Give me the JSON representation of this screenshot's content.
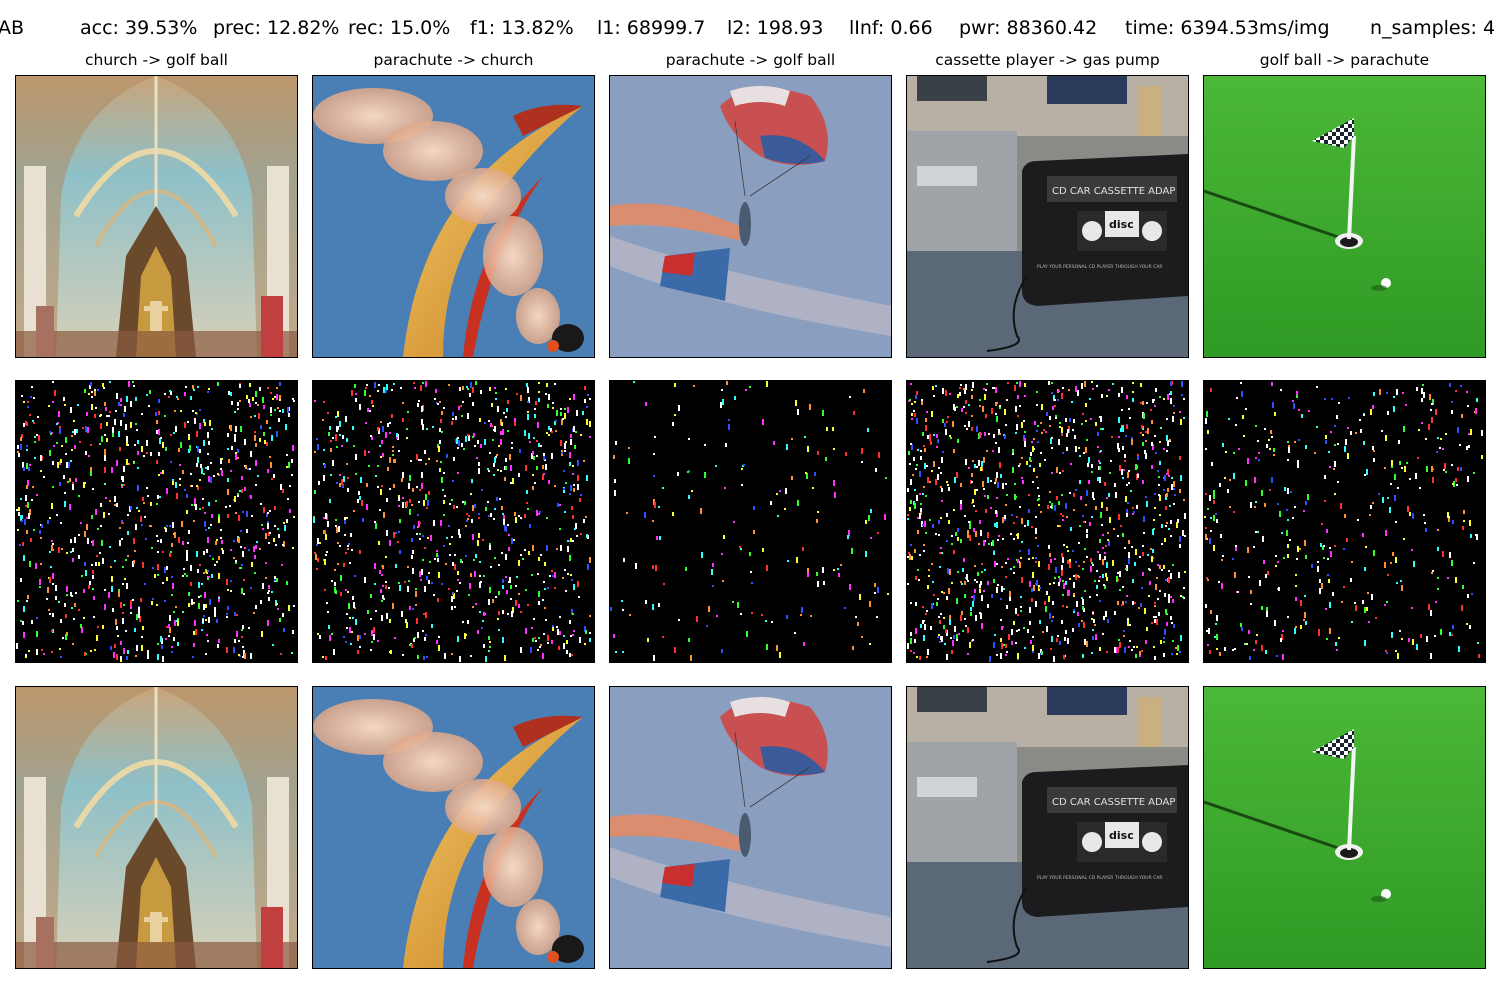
{
  "stats": {
    "method": "AB",
    "acc": "acc: 39.53%",
    "prec": "prec: 12.82%",
    "rec": "rec: 15.0%",
    "f1": "f1: 13.82%",
    "l1": "l1: 68999.7",
    "l2": "l2: 198.93",
    "linf": "lInf: 0.66",
    "pwr": "pwr: 88360.42",
    "time": "time: 6394.53ms/img",
    "n_samples": "n_samples: 4"
  },
  "columns": [
    {
      "title": "church -> golf ball",
      "scene": "church-interior"
    },
    {
      "title": "parachute -> church",
      "scene": "paraglider-smoke"
    },
    {
      "title": "parachute -> golf ball",
      "scene": "parachutist-flag"
    },
    {
      "title": "cassette player -> gas pump",
      "scene": "cassette-adapter"
    },
    {
      "title": "golf ball -> parachute",
      "scene": "golf-green-flag"
    }
  ],
  "rows": [
    "original",
    "perturbation",
    "adversarial"
  ],
  "cassette_text": {
    "label": "CD CAR CASSETTE ADAP",
    "badge": "disc",
    "subtext": "PLAY YOUR PERSONAL CD PLAYER THROUGH YOUR CAR"
  },
  "colors": {
    "background": "#ffffff",
    "noise_background": "#000000",
    "sky": "#4a7fb5",
    "pale_sky": "#8a9fc0",
    "grass": "#3fae2a",
    "church_vault": "#8ec0c8"
  }
}
